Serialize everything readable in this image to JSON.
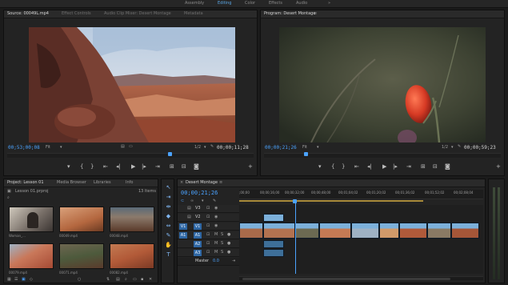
{
  "workspaces": [
    "Assembly",
    "Editing",
    "Color",
    "Effects",
    "Audio"
  ],
  "source_panel": {
    "tabs": [
      "Source: 00049L.mp4",
      "Effect Controls",
      "Audio Clip Mixer: Desert Montage",
      "Metadata"
    ],
    "timecode_left": "00;53;00;08",
    "fit": "Fit",
    "resolution": "1/2",
    "timecode_right": "00;00;11;28"
  },
  "program_panel": {
    "tabs": [
      "Program: Desert Montage"
    ],
    "timecode_left": "00;00;21;26",
    "fit": "Fit",
    "resolution": "1/2",
    "timecode_right": "00;00;59;23"
  },
  "project_panel": {
    "tabs": [
      "Project: Lesson 01",
      "Media Browser",
      "Libraries",
      "Info"
    ],
    "project_file": "Lesson 01.prproj",
    "item_count": "13 Items",
    "thumbnails": [
      {
        "label": "Woman_..."
      },
      {
        "label": "00049.mp4"
      },
      {
        "label": "00048.mp4"
      },
      {
        "label": "00079.mp4"
      },
      {
        "label": "00071.mp4"
      },
      {
        "label": "00082.mp4"
      }
    ]
  },
  "timeline_panel": {
    "tab": "Desert Montage",
    "timecode": "00;00;21;26",
    "ruler_labels": [
      ";00;00",
      "00;00;16;00",
      "00;00;32;00",
      "00;00;48;00",
      "00;01;04;02",
      "00;01;20;02",
      "00;01;36;02",
      "00;01;52;02",
      "00;02;08;04"
    ],
    "tracks": [
      {
        "label": "V3"
      },
      {
        "label": "V2"
      },
      {
        "label": "V1"
      },
      {
        "label": "A1"
      },
      {
        "label": "A2"
      },
      {
        "label": "A3"
      }
    ],
    "master_label": "Master",
    "master_value": "0.0"
  },
  "colors": {
    "accent": "#4ba3ff",
    "clip_video": "#7cb0da",
    "clip_audio": "#3e6f99",
    "panel_bg": "#232323"
  }
}
